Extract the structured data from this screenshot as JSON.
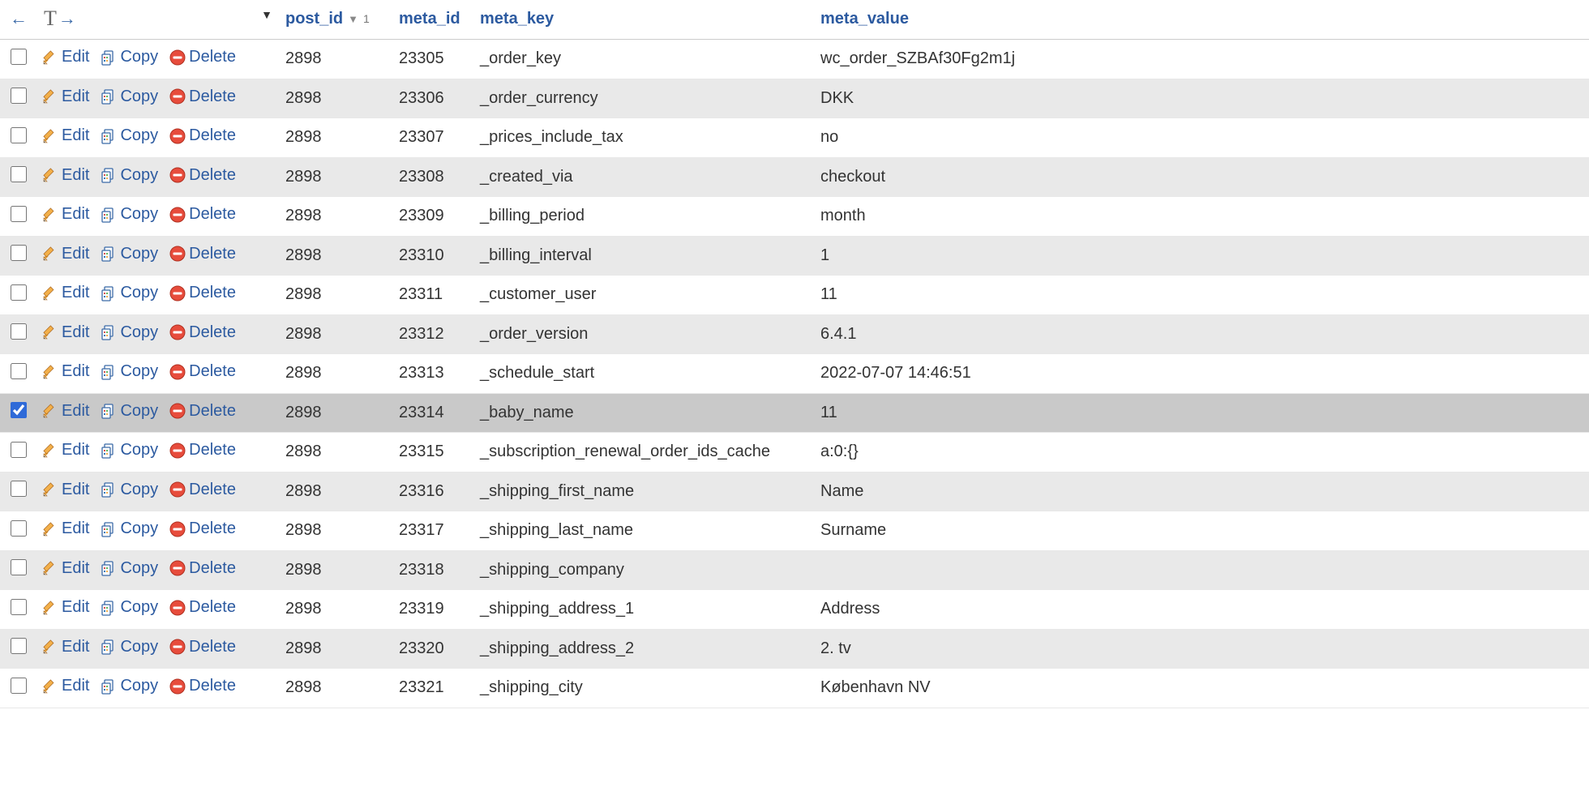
{
  "header": {
    "nav_t_label": "T",
    "columns": {
      "post_id": "post_id",
      "meta_id": "meta_id",
      "meta_key": "meta_key",
      "meta_value": "meta_value"
    },
    "sort_indicator_num": "1"
  },
  "actions": {
    "edit": "Edit",
    "copy": "Copy",
    "delete": "Delete"
  },
  "rows": [
    {
      "checked": false,
      "post_id": "2898",
      "meta_id": "23305",
      "meta_key": "_order_key",
      "meta_value": "wc_order_SZBAf30Fg2m1j"
    },
    {
      "checked": false,
      "post_id": "2898",
      "meta_id": "23306",
      "meta_key": "_order_currency",
      "meta_value": "DKK"
    },
    {
      "checked": false,
      "post_id": "2898",
      "meta_id": "23307",
      "meta_key": "_prices_include_tax",
      "meta_value": "no"
    },
    {
      "checked": false,
      "post_id": "2898",
      "meta_id": "23308",
      "meta_key": "_created_via",
      "meta_value": "checkout"
    },
    {
      "checked": false,
      "post_id": "2898",
      "meta_id": "23309",
      "meta_key": "_billing_period",
      "meta_value": "month"
    },
    {
      "checked": false,
      "post_id": "2898",
      "meta_id": "23310",
      "meta_key": "_billing_interval",
      "meta_value": "1"
    },
    {
      "checked": false,
      "post_id": "2898",
      "meta_id": "23311",
      "meta_key": "_customer_user",
      "meta_value": "11"
    },
    {
      "checked": false,
      "post_id": "2898",
      "meta_id": "23312",
      "meta_key": "_order_version",
      "meta_value": "6.4.1"
    },
    {
      "checked": false,
      "post_id": "2898",
      "meta_id": "23313",
      "meta_key": "_schedule_start",
      "meta_value": "2022-07-07 14:46:51"
    },
    {
      "checked": true,
      "post_id": "2898",
      "meta_id": "23314",
      "meta_key": "_baby_name",
      "meta_value": "11"
    },
    {
      "checked": false,
      "post_id": "2898",
      "meta_id": "23315",
      "meta_key": "_subscription_renewal_order_ids_cache",
      "meta_value": "a:0:{}"
    },
    {
      "checked": false,
      "post_id": "2898",
      "meta_id": "23316",
      "meta_key": "_shipping_first_name",
      "meta_value": "Name"
    },
    {
      "checked": false,
      "post_id": "2898",
      "meta_id": "23317",
      "meta_key": "_shipping_last_name",
      "meta_value": "Surname"
    },
    {
      "checked": false,
      "post_id": "2898",
      "meta_id": "23318",
      "meta_key": "_shipping_company",
      "meta_value": ""
    },
    {
      "checked": false,
      "post_id": "2898",
      "meta_id": "23319",
      "meta_key": "_shipping_address_1",
      "meta_value": "Address"
    },
    {
      "checked": false,
      "post_id": "2898",
      "meta_id": "23320",
      "meta_key": "_shipping_address_2",
      "meta_value": "2. tv"
    },
    {
      "checked": false,
      "post_id": "2898",
      "meta_id": "23321",
      "meta_key": "_shipping_city",
      "meta_value": "København NV"
    }
  ]
}
